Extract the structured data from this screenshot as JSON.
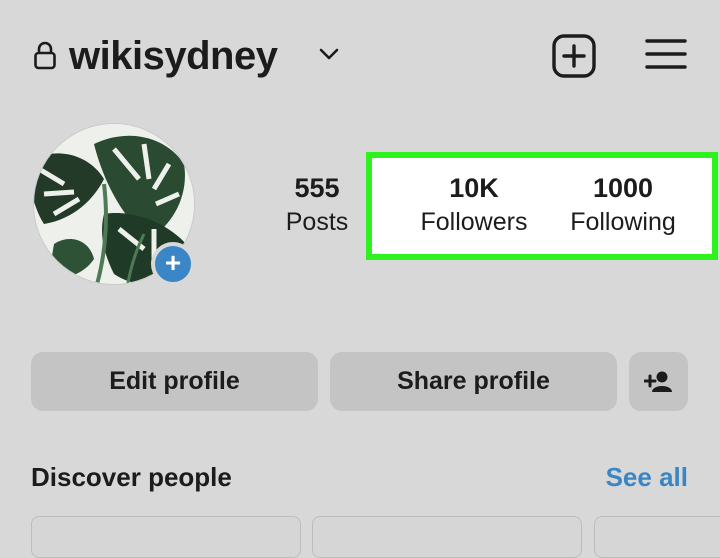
{
  "header": {
    "username": "wikisydney",
    "lock_icon": "lock-icon",
    "dropdown_icon": "chevron-down-icon",
    "new_post_icon": "plus-square-icon",
    "menu_icon": "hamburger-menu-icon"
  },
  "profile": {
    "avatar_icon": "avatar",
    "add_story_icon": "plus-icon",
    "add_story_glyph": "+"
  },
  "stats": {
    "posts": {
      "value": "555",
      "label": "Posts"
    },
    "followers": {
      "value": "10K",
      "label": "Followers"
    },
    "following": {
      "value": "1000",
      "label": "Following"
    },
    "highlight_color": "#2ef21e"
  },
  "actions": {
    "edit_label": "Edit profile",
    "share_label": "Share profile",
    "add_user_icon": "add-person-icon"
  },
  "discover": {
    "title": "Discover people",
    "see_all": "See all",
    "link_color": "#3a86c5"
  }
}
